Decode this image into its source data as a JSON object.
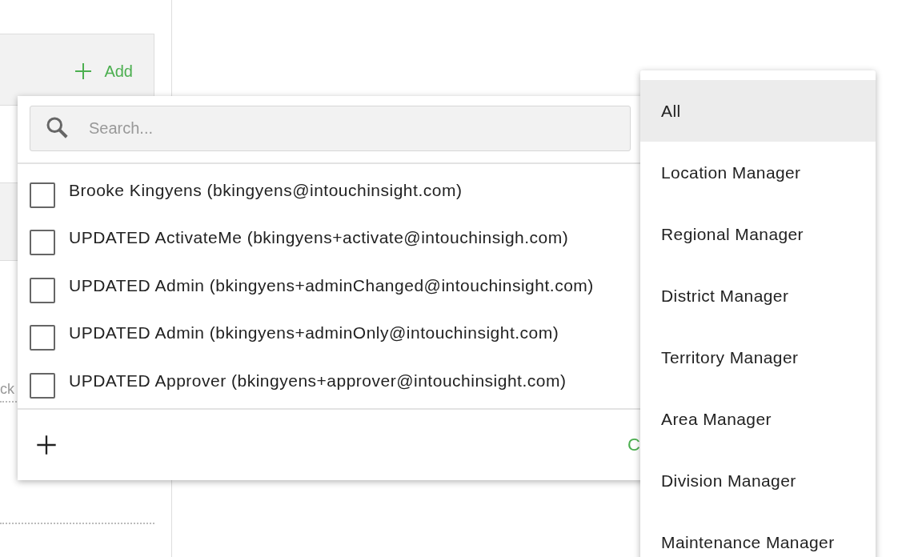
{
  "add_button": {
    "label": "Add"
  },
  "background": {
    "partial_text": "ck"
  },
  "user_picker": {
    "search": {
      "placeholder": "Search..."
    },
    "users": [
      {
        "label": "Brooke Kingyens (bkingyens@intouchinsight.com)",
        "checked": false
      },
      {
        "label": "UPDATED ActivateMe (bkingyens+activate@intouchinsigh.com)",
        "checked": false
      },
      {
        "label": "UPDATED Admin (bkingyens+adminChanged@intouchinsight.com)",
        "checked": false
      },
      {
        "label": "UPDATED Admin (bkingyens+adminOnly@intouchinsight.com)",
        "checked": false
      },
      {
        "label": "UPDATED Approver (bkingyens+approver@intouchinsight.com)",
        "checked": false
      }
    ],
    "footer_action": "C"
  },
  "role_menu": {
    "items": [
      {
        "label": "All",
        "selected": true
      },
      {
        "label": "Location Manager",
        "selected": false
      },
      {
        "label": "Regional Manager",
        "selected": false
      },
      {
        "label": "District Manager",
        "selected": false
      },
      {
        "label": "Territory Manager",
        "selected": false
      },
      {
        "label": "Area Manager",
        "selected": false
      },
      {
        "label": "Division Manager",
        "selected": false
      },
      {
        "label": "Maintenance Manager",
        "selected": false
      }
    ]
  }
}
